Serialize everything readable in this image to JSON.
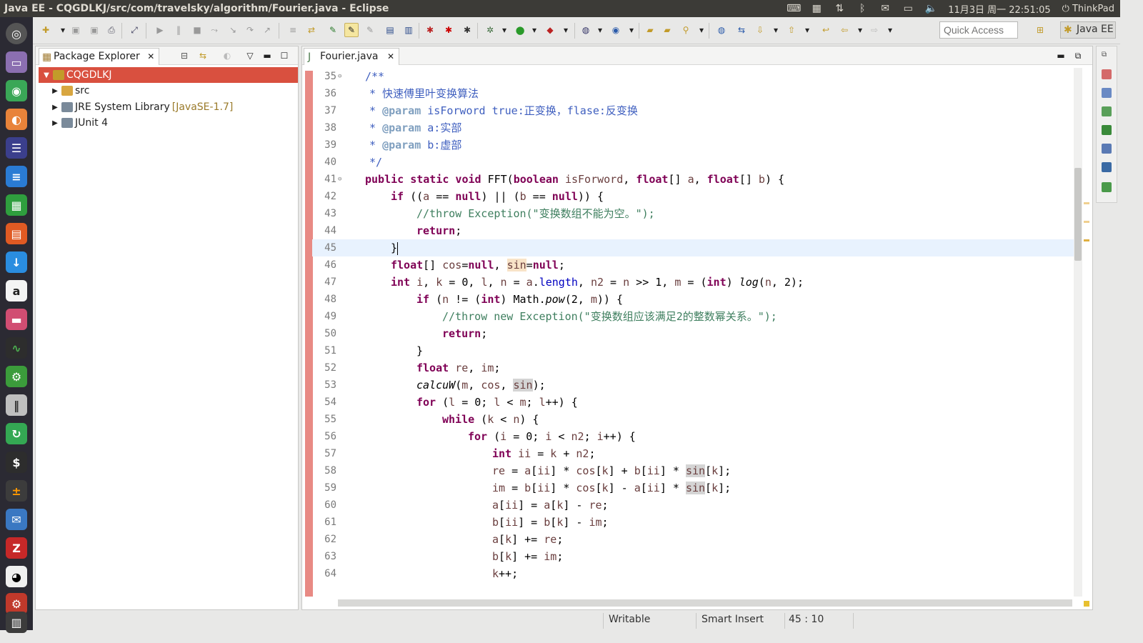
{
  "window": {
    "title": "Java EE - CQGDLKJ/src/com/travelsky/algorithm/Fourier.java - Eclipse"
  },
  "system_tray": {
    "datetime": "11月3日 周一 22:51:05",
    "user": "ThinkPad"
  },
  "toolbar": {
    "quick_access_placeholder": "Quick Access",
    "perspective_label": "Java EE"
  },
  "package_explorer": {
    "tab_label": "Package Explorer",
    "items": [
      {
        "label": "CQGDLKJ",
        "decoration": ""
      },
      {
        "label": "src",
        "decoration": ""
      },
      {
        "label": "JRE System Library",
        "decoration": "[JavaSE-1.7]"
      },
      {
        "label": "JUnit 4",
        "decoration": ""
      }
    ]
  },
  "editor": {
    "tab_label": "Fourier.java",
    "line_numbers": [
      "35",
      "36",
      "37",
      "38",
      "39",
      "40",
      "41",
      "42",
      "43",
      "44",
      "45",
      "46",
      "47",
      "48",
      "49",
      "50",
      "51",
      "52",
      "53",
      "54",
      "55",
      "56",
      "57",
      "58",
      "59",
      "60",
      "61",
      "62",
      "63",
      "64"
    ],
    "current_line": "45"
  },
  "status_bar": {
    "mode": "Writable",
    "insert_mode": "Smart Insert",
    "position": "45 : 10"
  },
  "colors": {
    "selection_accent": "#d9503f",
    "title_bar": "#3c3b37",
    "launcher": "#2b2a33",
    "keyword": "#7f0055",
    "javadoc": "#3f5fbf",
    "comment": "#3f7f5f"
  }
}
